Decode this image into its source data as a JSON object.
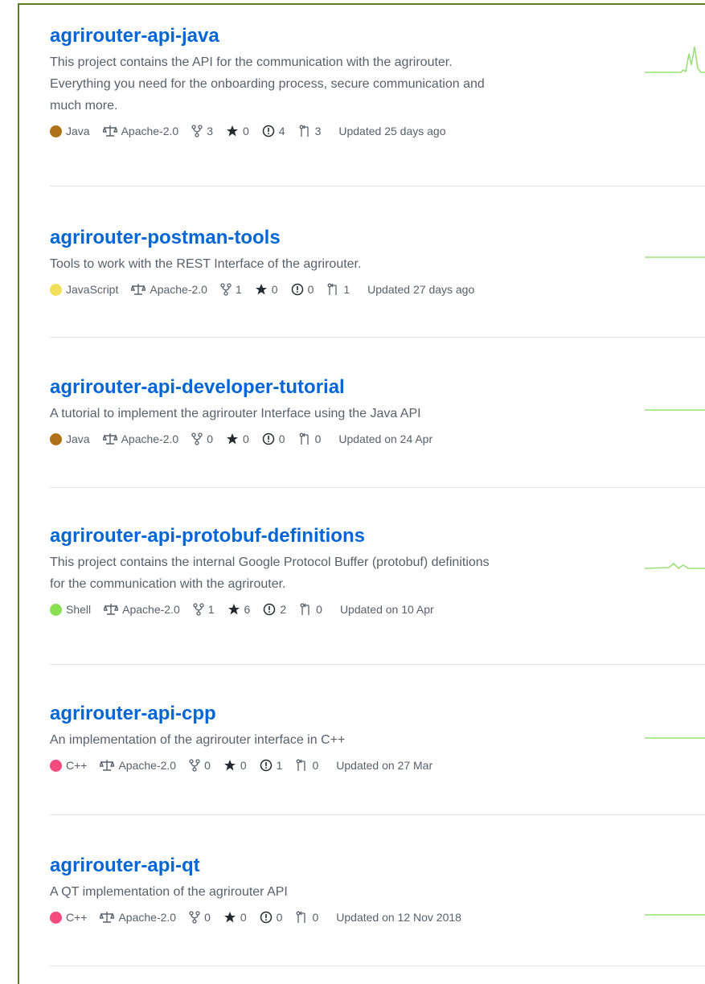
{
  "repos": [
    {
      "name": "agrirouter-api-java",
      "desc_lines": [
        "This project contains the API for the communication with the agrirouter.",
        "Everything you need for the onboarding process, secure communication and",
        "much more."
      ],
      "language": "Java",
      "lang_color": "#b07219",
      "license": "Apache-2.0",
      "forks": "3",
      "stars": "0",
      "issues": "4",
      "prs": "3",
      "updated": "Updated 25 days ago"
    },
    {
      "name": "agrirouter-postman-tools",
      "desc_lines": [
        "Tools to work with the REST Interface of the agrirouter."
      ],
      "language": "JavaScript",
      "lang_color": "#f1e05a",
      "license": "Apache-2.0",
      "forks": "1",
      "stars": "0",
      "issues": "0",
      "prs": "1",
      "updated": "Updated 27 days ago"
    },
    {
      "name": "agrirouter-api-developer-tutorial",
      "desc_lines": [
        "A tutorial to implement the agrirouter Interface using the Java API"
      ],
      "language": "Java",
      "lang_color": "#b07219",
      "license": "Apache-2.0",
      "forks": "0",
      "stars": "0",
      "issues": "0",
      "prs": "0",
      "updated": "Updated on 24 Apr"
    },
    {
      "name": "agrirouter-api-protobuf-definitions",
      "desc_lines": [
        "This project contains the internal Google Protocol Buffer (protobuf) definitions",
        "for the communication with the agrirouter."
      ],
      "language": "Shell",
      "lang_color": "#89e051",
      "license": "Apache-2.0",
      "forks": "1",
      "stars": "6",
      "issues": "2",
      "prs": "0",
      "updated": "Updated on 10 Apr"
    },
    {
      "name": "agrirouter-api-cpp",
      "desc_lines": [
        "An implementation of the agrirouter interface in C++"
      ],
      "language": "C++",
      "lang_color": "#f34b7d",
      "license": "Apache-2.0",
      "forks": "0",
      "stars": "0",
      "issues": "1",
      "prs": "0",
      "updated": "Updated on 27 Mar"
    },
    {
      "name": "agrirouter-api-qt",
      "desc_lines": [
        "A QT implementation of the agrirouter API"
      ],
      "language": "C++",
      "lang_color": "#f34b7d",
      "license": "Apache-2.0",
      "forks": "0",
      "stars": "0",
      "issues": "0",
      "prs": "0",
      "updated": "Updated on 12 Nov 2018"
    }
  ],
  "colors": {
    "accent": "#0366d6",
    "spark": "#9be07a",
    "frame": "#5b7d1a"
  }
}
